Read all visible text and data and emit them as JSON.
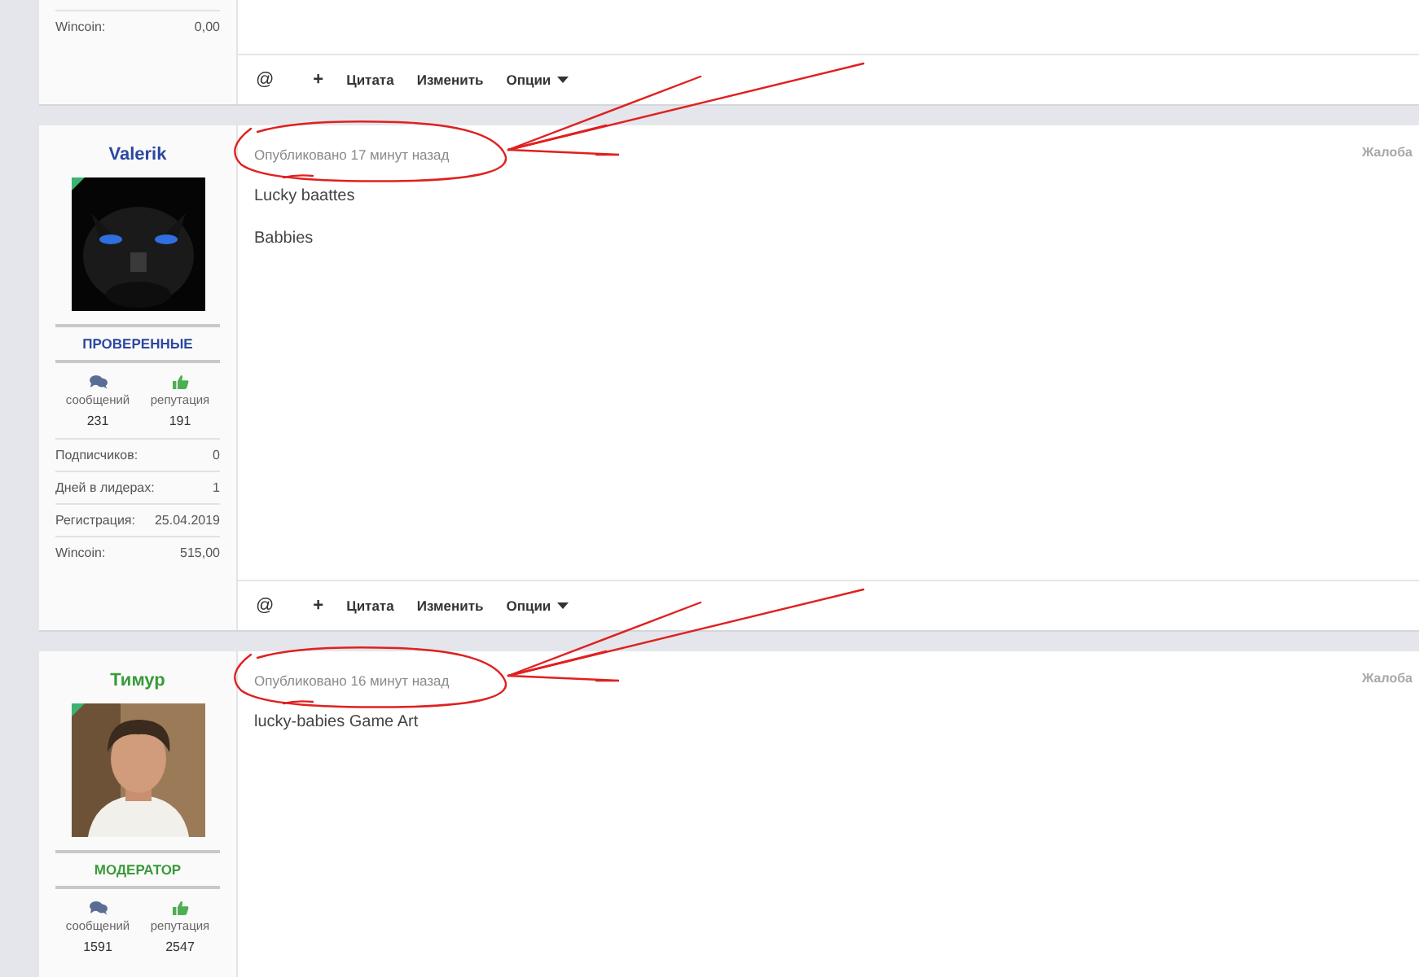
{
  "posts": [
    {
      "profile_fields": [
        {
          "label": "Wincoin:",
          "value": "0,00"
        }
      ],
      "actions": [
        {
          "kind": "mention",
          "label": "@"
        },
        {
          "kind": "add",
          "label": "+"
        },
        {
          "kind": "text",
          "label": "Цитата"
        },
        {
          "kind": "text",
          "label": "Изменить"
        },
        {
          "kind": "menu",
          "label": "Опции"
        }
      ]
    },
    {
      "author": {
        "name": "Valerik",
        "color": "#2b47a0",
        "online": true,
        "group": "ПРОВЕРЕННЫЕ"
      },
      "stats": [
        {
          "kind": "posts",
          "label": "сообщений",
          "value": "231"
        },
        {
          "kind": "reputation",
          "label": "репутация",
          "value": "191"
        }
      ],
      "profile_fields": [
        {
          "label": "Подписчиков:",
          "value": "0"
        },
        {
          "label": "Дней в лидерах:",
          "value": "1"
        },
        {
          "label": "Регистрация:",
          "value": "25.04.2019"
        },
        {
          "label": "Wincoin:",
          "value": "515,00"
        }
      ],
      "published": "Опубликовано 17 минут назад",
      "report": "Жалоба",
      "highlighted": true,
      "content": [
        "Lucky baattes",
        "Babbies"
      ],
      "actions": [
        {
          "kind": "mention",
          "label": "@"
        },
        {
          "kind": "add",
          "label": "+"
        },
        {
          "kind": "text",
          "label": "Цитата"
        },
        {
          "kind": "text",
          "label": "Изменить"
        },
        {
          "kind": "menu",
          "label": "Опции"
        }
      ]
    },
    {
      "author": {
        "name": "Тимур",
        "color": "#3a9a3a",
        "online": true,
        "group": "МОДЕРАТОР"
      },
      "stats": [
        {
          "kind": "posts",
          "label": "сообщений",
          "value": "1591"
        },
        {
          "kind": "reputation",
          "label": "репутация",
          "value": "2547"
        }
      ],
      "published": "Опубликовано 16 минут назад",
      "report": "Жалоба",
      "highlighted": true,
      "content": [
        "lucky-babies  Game Art"
      ]
    }
  ]
}
